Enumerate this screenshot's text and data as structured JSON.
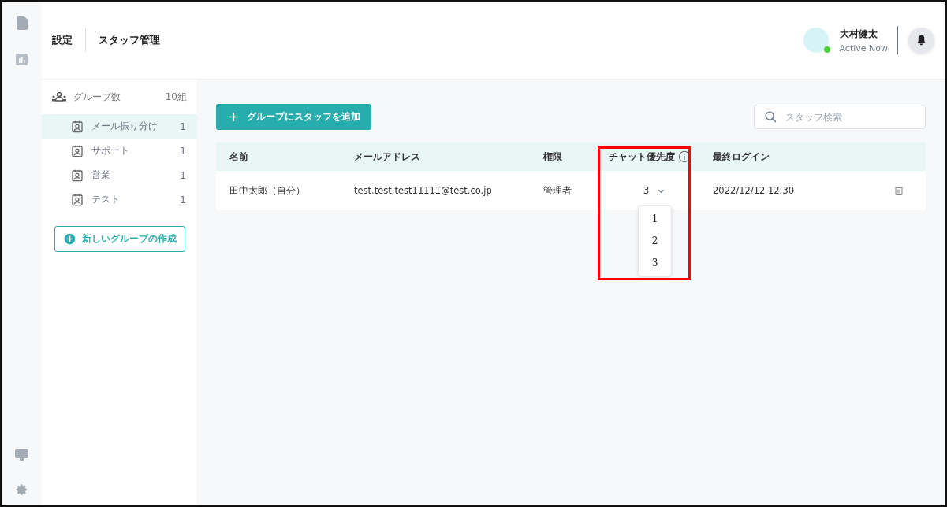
{
  "header": {
    "breadcrumb": [
      "設定",
      "スタッフ管理"
    ],
    "user": {
      "name": "大村健太",
      "status": "Active Now",
      "online": true
    }
  },
  "groups": {
    "label": "グループ数",
    "count": "10組",
    "items": [
      {
        "name": "メール振り分け",
        "count": "1",
        "selected": true
      },
      {
        "name": "サポート",
        "count": "1",
        "selected": false
      },
      {
        "name": "営業",
        "count": "1",
        "selected": false
      },
      {
        "name": "テスト",
        "count": "1",
        "selected": false
      }
    ],
    "create_button": "新しいグループの作成"
  },
  "add_button": "グループにスタッフを追加",
  "search": {
    "placeholder": "スタッフ検索"
  },
  "table": {
    "columns": [
      "名前",
      "メールアドレス",
      "権限",
      "チャット優先度",
      "最終ログイン"
    ],
    "rows": [
      {
        "name": "田中太郎（自分）",
        "email": "test.test.test11111@test.co.jp",
        "role": "管理者",
        "priority": {
          "value": "3",
          "expanded": true,
          "options": [
            "1",
            "2",
            "3"
          ]
        },
        "last_login": "2022/12/12 12:30"
      }
    ]
  }
}
